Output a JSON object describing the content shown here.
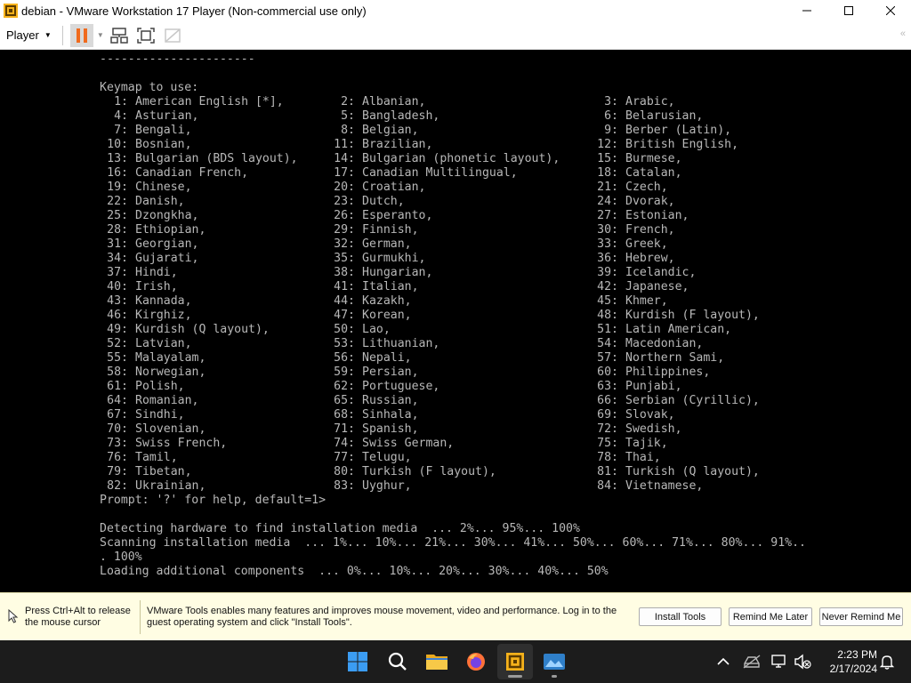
{
  "window": {
    "title": "debian - VMware Workstation 17 Player (Non-commercial use only)"
  },
  "toolbar": {
    "player_label": "Player"
  },
  "console": {
    "separator": "----------------------",
    "keymap_header": "Keymap to use:",
    "keymaps": [
      {
        "n": "1:",
        "name": "American English [*],"
      },
      {
        "n": "2:",
        "name": "Albanian,"
      },
      {
        "n": "3:",
        "name": "Arabic,"
      },
      {
        "n": "4:",
        "name": "Asturian,"
      },
      {
        "n": "5:",
        "name": "Bangladesh,"
      },
      {
        "n": "6:",
        "name": "Belarusian,"
      },
      {
        "n": "7:",
        "name": "Bengali,"
      },
      {
        "n": "8:",
        "name": "Belgian,"
      },
      {
        "n": "9:",
        "name": "Berber (Latin),"
      },
      {
        "n": "10:",
        "name": "Bosnian,"
      },
      {
        "n": "11:",
        "name": "Brazilian,"
      },
      {
        "n": "12:",
        "name": "British English,"
      },
      {
        "n": "13:",
        "name": "Bulgarian (BDS layout),"
      },
      {
        "n": "14:",
        "name": "Bulgarian (phonetic layout),"
      },
      {
        "n": "15:",
        "name": "Burmese,"
      },
      {
        "n": "16:",
        "name": "Canadian French,"
      },
      {
        "n": "17:",
        "name": "Canadian Multilingual,"
      },
      {
        "n": "18:",
        "name": "Catalan,"
      },
      {
        "n": "19:",
        "name": "Chinese,"
      },
      {
        "n": "20:",
        "name": "Croatian,"
      },
      {
        "n": "21:",
        "name": "Czech,"
      },
      {
        "n": "22:",
        "name": "Danish,"
      },
      {
        "n": "23:",
        "name": "Dutch,"
      },
      {
        "n": "24:",
        "name": "Dvorak,"
      },
      {
        "n": "25:",
        "name": "Dzongkha,"
      },
      {
        "n": "26:",
        "name": "Esperanto,"
      },
      {
        "n": "27:",
        "name": "Estonian,"
      },
      {
        "n": "28:",
        "name": "Ethiopian,"
      },
      {
        "n": "29:",
        "name": "Finnish,"
      },
      {
        "n": "30:",
        "name": "French,"
      },
      {
        "n": "31:",
        "name": "Georgian,"
      },
      {
        "n": "32:",
        "name": "German,"
      },
      {
        "n": "33:",
        "name": "Greek,"
      },
      {
        "n": "34:",
        "name": "Gujarati,"
      },
      {
        "n": "35:",
        "name": "Gurmukhi,"
      },
      {
        "n": "36:",
        "name": "Hebrew,"
      },
      {
        "n": "37:",
        "name": "Hindi,"
      },
      {
        "n": "38:",
        "name": "Hungarian,"
      },
      {
        "n": "39:",
        "name": "Icelandic,"
      },
      {
        "n": "40:",
        "name": "Irish,"
      },
      {
        "n": "41:",
        "name": "Italian,"
      },
      {
        "n": "42:",
        "name": "Japanese,"
      },
      {
        "n": "43:",
        "name": "Kannada,"
      },
      {
        "n": "44:",
        "name": "Kazakh,"
      },
      {
        "n": "45:",
        "name": "Khmer,"
      },
      {
        "n": "46:",
        "name": "Kirghiz,"
      },
      {
        "n": "47:",
        "name": "Korean,"
      },
      {
        "n": "48:",
        "name": "Kurdish (F layout),"
      },
      {
        "n": "49:",
        "name": "Kurdish (Q layout),"
      },
      {
        "n": "50:",
        "name": "Lao,"
      },
      {
        "n": "51:",
        "name": "Latin American,"
      },
      {
        "n": "52:",
        "name": "Latvian,"
      },
      {
        "n": "53:",
        "name": "Lithuanian,"
      },
      {
        "n": "54:",
        "name": "Macedonian,"
      },
      {
        "n": "55:",
        "name": "Malayalam,"
      },
      {
        "n": "56:",
        "name": "Nepali,"
      },
      {
        "n": "57:",
        "name": "Northern Sami,"
      },
      {
        "n": "58:",
        "name": "Norwegian,"
      },
      {
        "n": "59:",
        "name": "Persian,"
      },
      {
        "n": "60:",
        "name": "Philippines,"
      },
      {
        "n": "61:",
        "name": "Polish,"
      },
      {
        "n": "62:",
        "name": "Portuguese,"
      },
      {
        "n": "63:",
        "name": "Punjabi,"
      },
      {
        "n": "64:",
        "name": "Romanian,"
      },
      {
        "n": "65:",
        "name": "Russian,"
      },
      {
        "n": "66:",
        "name": "Serbian (Cyrillic),"
      },
      {
        "n": "67:",
        "name": "Sindhi,"
      },
      {
        "n": "68:",
        "name": "Sinhala,"
      },
      {
        "n": "69:",
        "name": "Slovak,"
      },
      {
        "n": "70:",
        "name": "Slovenian,"
      },
      {
        "n": "71:",
        "name": "Spanish,"
      },
      {
        "n": "72:",
        "name": "Swedish,"
      },
      {
        "n": "73:",
        "name": "Swiss French,"
      },
      {
        "n": "74:",
        "name": "Swiss German,"
      },
      {
        "n": "75:",
        "name": "Tajik,"
      },
      {
        "n": "76:",
        "name": "Tamil,"
      },
      {
        "n": "77:",
        "name": "Telugu,"
      },
      {
        "n": "78:",
        "name": "Thai,"
      },
      {
        "n": "79:",
        "name": "Tibetan,"
      },
      {
        "n": "80:",
        "name": "Turkish (F layout),"
      },
      {
        "n": "81:",
        "name": "Turkish (Q layout),"
      },
      {
        "n": "82:",
        "name": "Ukrainian,"
      },
      {
        "n": "83:",
        "name": "Uyghur,"
      },
      {
        "n": "84:",
        "name": "Vietnamese,"
      }
    ],
    "prompt": "Prompt: '?' for help, default=1>",
    "log_lines": [
      "Detecting hardware to find installation media  ... 2%... 95%... 100%",
      "Scanning installation media  ... 1%... 10%... 21%... 30%... 41%... 50%... 60%... 71%... 80%... 91%..",
      ". 100%",
      "Loading additional components  ... 0%... 10%... 20%... 30%... 40%... 50%"
    ]
  },
  "notification": {
    "release_line1": "Press Ctrl+Alt to release",
    "release_line2": "the mouse cursor",
    "message_line1": "VMware Tools enables many features and improves mouse movement, video and performance. Log in to the",
    "message_line2": "guest operating system and click \"Install Tools\".",
    "install_label": "Install Tools",
    "remind_later_label": "Remind Me Later",
    "never_remind_label": "Never Remind Me"
  },
  "taskbar": {
    "time": "2:23 PM",
    "date": "2/17/2024"
  },
  "colors": {
    "console_text": "#b8b8b8",
    "console_bg": "#000000",
    "notification_bg": "#fffde3",
    "taskbar_bg": "#1c1c1c",
    "pause_orange": "#f06a1d",
    "windows_blue": "#3b9cf2"
  }
}
